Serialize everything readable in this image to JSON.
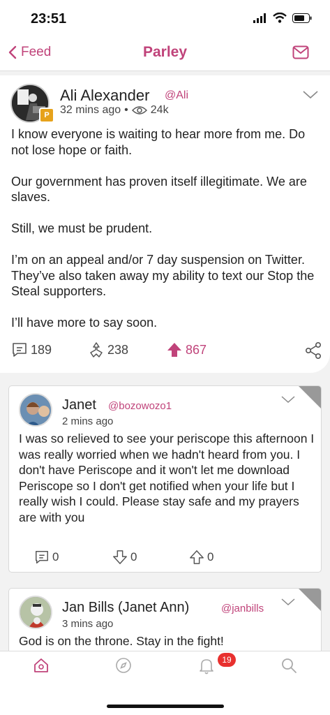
{
  "status_bar": {
    "time": "23:51"
  },
  "nav": {
    "back_label": "Feed",
    "title": "Parley",
    "accent": "#c0437a"
  },
  "post": {
    "author_name": "Ali Alexander",
    "author_handle": "@Ali",
    "time": "32 mins ago",
    "views": "24k",
    "body": "I know everyone is waiting to hear more from me. Do not lose hope or faith.\n\nOur government has proven itself illegitimate. We are slaves.\n\nStill, we must be prudent.\n\nI’m on an appeal and/or 7 day suspension on Twitter. They’ve also taken away my ability to text our Stop the Steal supporters.\n\nI’ll have more to say soon.",
    "comments": "189",
    "echoes": "238",
    "upvotes": "867"
  },
  "comments": [
    {
      "name": "Janet",
      "handle": "@bozowozo1",
      "time": "2 mins ago",
      "body": "I was so relieved to see your periscope this afternoon I was really worried when we hadn't heard from you. I don't have Periscope and it won't let me download Periscope so I don't get notified when your life but I really wish I could. Please stay safe and my prayers are with you",
      "replies": "0",
      "downvotes": "0",
      "upvotes": "0"
    },
    {
      "name": "Jan Bills (Janet Ann)",
      "handle": "@janbills",
      "time": "3 mins ago",
      "body": "God is on the throne. Stay in the fight!"
    }
  ],
  "tabbar": {
    "notification_count": "19"
  },
  "icons": [
    "chevron-left-icon",
    "mail-icon",
    "chevron-down-icon",
    "eye-icon",
    "comment-icon",
    "echo-icon",
    "upvote-icon",
    "share-icon",
    "downvote-icon",
    "home-icon",
    "compass-icon",
    "bell-icon",
    "search-icon"
  ]
}
